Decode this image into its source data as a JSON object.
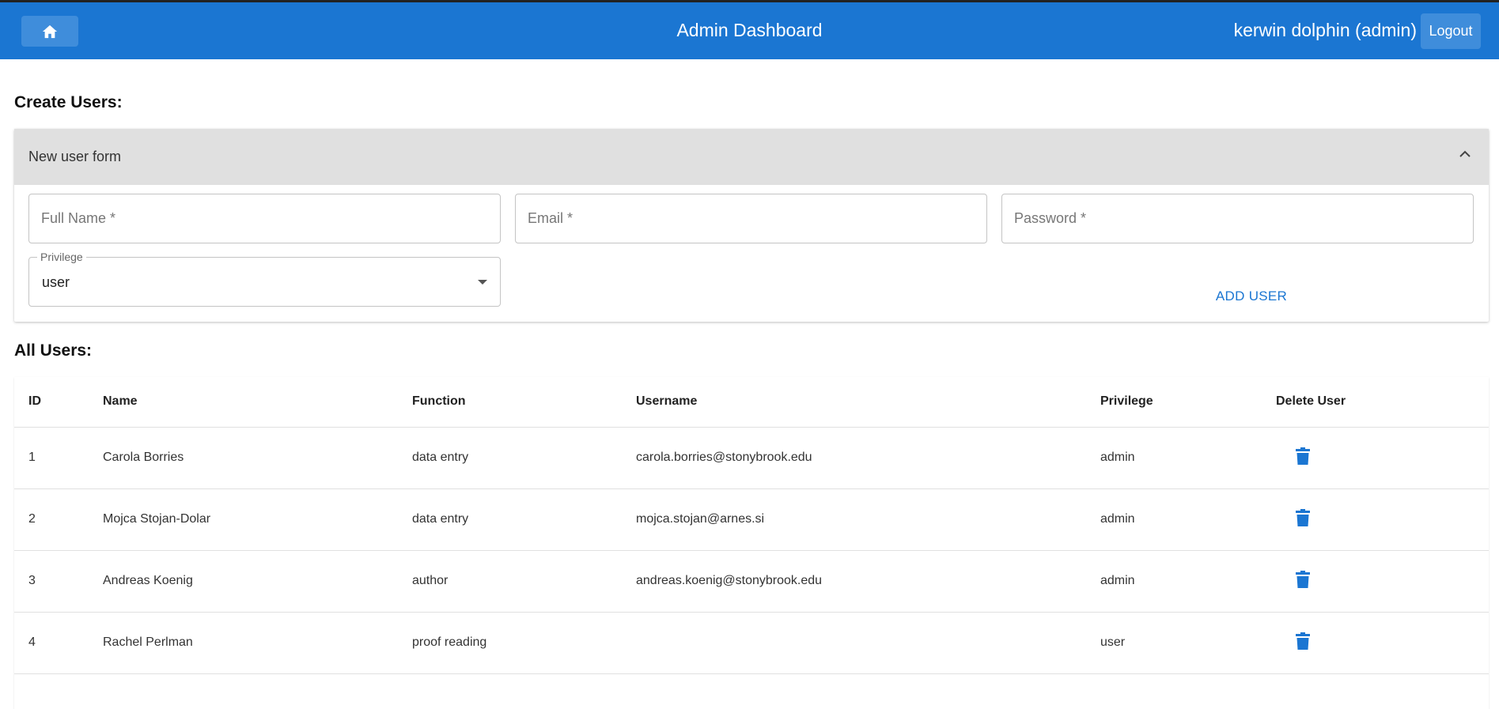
{
  "header": {
    "title": "Admin Dashboard",
    "user_label": "kerwin dolphin (admin)",
    "logout_label": "Logout",
    "accent": "#1b76d2"
  },
  "create": {
    "heading": "Create Users:",
    "form_title": "New user form",
    "fields": {
      "full_name_placeholder": "Full Name *",
      "email_placeholder": "Email *",
      "password_placeholder": "Password *"
    },
    "privilege": {
      "label": "Privilege",
      "value": "user"
    },
    "add_button": "ADD USER"
  },
  "users": {
    "heading": "All Users:",
    "columns": [
      "ID",
      "Name",
      "Function",
      "Username",
      "Privilege",
      "Delete User"
    ],
    "rows": [
      {
        "id": "1",
        "name": "Carola Borries",
        "function": "data entry",
        "username": "carola.borries@stonybrook.edu",
        "privilege": "admin"
      },
      {
        "id": "2",
        "name": "Mojca Stojan-Dolar",
        "function": "data entry",
        "username": "mojca.stojan@arnes.si",
        "privilege": "admin"
      },
      {
        "id": "3",
        "name": "Andreas Koenig",
        "function": "author",
        "username": "andreas.koenig@stonybrook.edu",
        "privilege": "admin"
      },
      {
        "id": "4",
        "name": "Rachel Perlman",
        "function": "proof reading",
        "username": "",
        "privilege": "user"
      }
    ]
  }
}
